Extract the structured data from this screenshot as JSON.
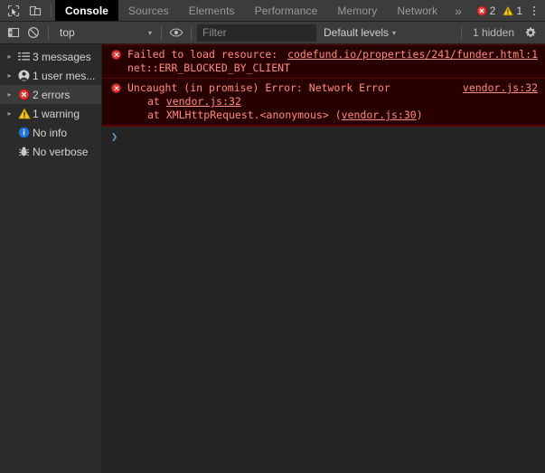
{
  "window": {
    "app": "Chrome DevTools",
    "accent_error": "#e53935",
    "accent_warning": "#f5c518",
    "accent_info": "#1a73e8",
    "error_bg": "#290000",
    "error_border": "#5c0000",
    "panel_bg": "#242424",
    "sidebar_bg": "#2b2b2b",
    "toolbar_bg": "#3c3c3c"
  },
  "tabbar": {
    "icons": [
      {
        "name": "inspect-element-icon",
        "title": "Inspect element"
      },
      {
        "name": "device-toolbar-icon",
        "title": "Toggle device toolbar"
      }
    ],
    "tabs": [
      {
        "label": "Console",
        "active": true
      },
      {
        "label": "Sources",
        "active": false
      },
      {
        "label": "Elements",
        "active": false
      },
      {
        "label": "Performance",
        "active": false
      },
      {
        "label": "Memory",
        "active": false
      },
      {
        "label": "Network",
        "active": false
      }
    ],
    "more_label": "»",
    "error_count": "2",
    "warning_count": "1",
    "menu_label": "Customize and control DevTools"
  },
  "console_toolbar": {
    "clear_label": "Clear console",
    "sidebar_toggle_label": "Show console sidebar",
    "context_value": "top",
    "context_caret": "▾",
    "live_expression_label": "Create live expression",
    "filter_placeholder": "Filter",
    "filter_value": "",
    "levels_label": "Default levels",
    "levels_caret": "▾",
    "hidden_label": "1 hidden",
    "settings_label": "Console settings"
  },
  "sidebar": {
    "items": [
      {
        "label": "3 messages",
        "icon": "list-icon",
        "expandable": true,
        "selected": false
      },
      {
        "label": "1 user mes...",
        "icon": "user-icon",
        "expandable": true,
        "selected": false
      },
      {
        "label": "2 errors",
        "icon": "error-icon",
        "expandable": true,
        "selected": true
      },
      {
        "label": "1 warning",
        "icon": "warning-icon",
        "expandable": true,
        "selected": false
      },
      {
        "label": "No info",
        "icon": "info-icon",
        "expandable": false,
        "selected": false
      },
      {
        "label": "No verbose",
        "icon": "verbose-bug-icon",
        "expandable": false,
        "selected": false
      }
    ]
  },
  "console": {
    "messages": [
      {
        "level": "error",
        "text": "Failed to load resource:",
        "source_link": "codefund.io/properties/241/funder.html:1",
        "detail": "net::ERR_BLOCKED_BY_CLIENT"
      },
      {
        "level": "error",
        "text": "Uncaught (in promise) Error: Network Error",
        "source_link": "vendor.js:32",
        "stack": [
          {
            "prefix": "at ",
            "link": "vendor.js:32",
            "suffix": ""
          },
          {
            "prefix": "at XMLHttpRequest.<anonymous> (",
            "link": "vendor.js:30",
            "suffix": ")"
          }
        ]
      }
    ],
    "prompt_symbol": "❯",
    "prompt_value": ""
  }
}
